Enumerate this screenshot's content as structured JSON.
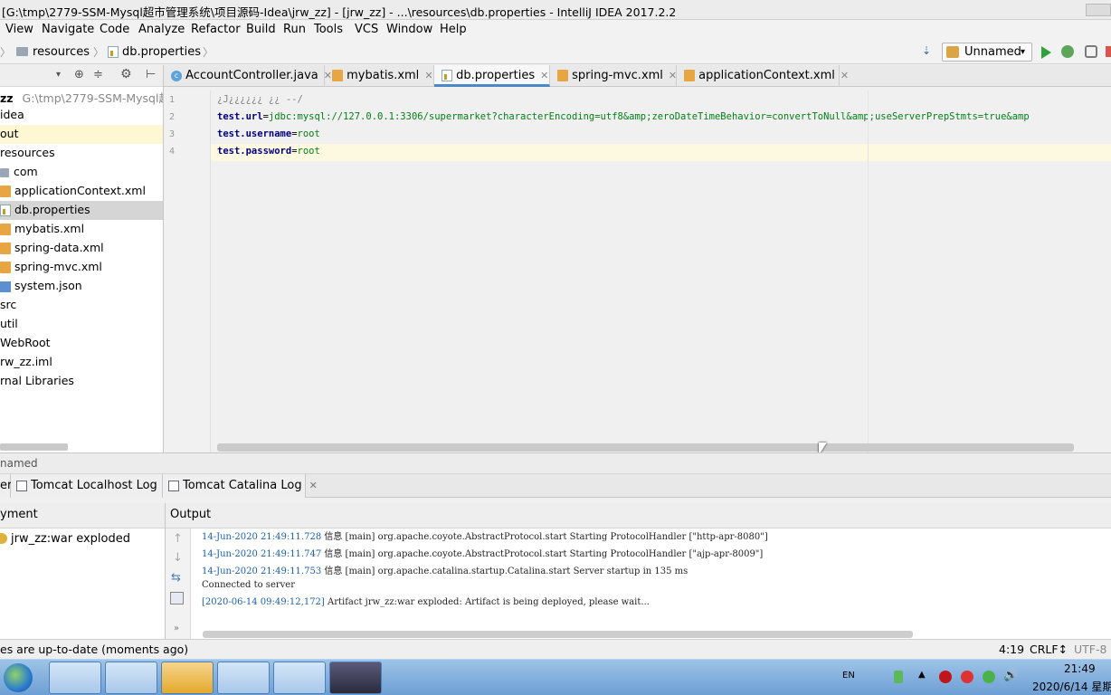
{
  "window": {
    "title": "[G:\\tmp\\2779-SSM-Mysql超市管理系统\\项目源码-Idea\\jrw_zz] - [jrw_zz] - ...\\resources\\db.properties - IntelliJ IDEA 2017.2.2"
  },
  "menu": [
    "View",
    "Navigate",
    "Code",
    "Analyze",
    "Refactor",
    "Build",
    "Run",
    "Tools",
    "VCS",
    "Window",
    "Help"
  ],
  "breadcrumb": {
    "folder": "resources",
    "file": "db.properties"
  },
  "run_config": {
    "name": "Unnamed"
  },
  "project": {
    "root_label": "zz",
    "root_path": "G:\\tmp\\2779-SSM-Mysql超市",
    "items": [
      "idea",
      "out",
      "resources",
      "com",
      "applicationContext.xml",
      "db.properties",
      "mybatis.xml",
      "spring-data.xml",
      "spring-mvc.xml",
      "system.json",
      "src",
      "util",
      "WebRoot",
      "rw_zz.iml",
      "rnal Libraries"
    ]
  },
  "tabs": [
    "AccountController.java",
    "mybatis.xml",
    "db.properties",
    "spring-mvc.xml",
    "applicationContext.xml"
  ],
  "editor": {
    "line_numbers": [
      "1",
      "2",
      "3",
      "4"
    ],
    "line1": "¿J¿¿¿¿¿¿  ¿¿ --/",
    "line2_key": "test.url",
    "line2_val": "jdbc:mysql://127.0.0.1:3306/supermarket?characterEncoding=utf8&amp;zeroDateTimeBehavior=convertToNull&amp;useServerPrepStmts=true&amp",
    "line3_key": "test.username",
    "line3_val": "root",
    "line4_key": "test.password",
    "line4_val": "root",
    "eq": "="
  },
  "run_panel": {
    "header": "named",
    "tab_left": "er",
    "tabs": [
      "Tomcat Localhost Log",
      "Tomcat Catalina Log"
    ],
    "deployment_label": "yment",
    "deployment_item": "jrw_zz:war exploded",
    "output_label": "Output",
    "logs": [
      {
        "date": "14-Jun-2020 21:49:11.728",
        "text": " 信息 [main] org.apache.coyote.AbstractProtocol.start Starting ProtocolHandler [\"http-apr-8080\"]"
      },
      {
        "date": "14-Jun-2020 21:49:11.747",
        "text": " 信息 [main] org.apache.coyote.AbstractProtocol.start Starting ProtocolHandler [\"ajp-apr-8009\"]"
      },
      {
        "date": "14-Jun-2020 21:49:11.753",
        "text": " 信息 [main] org.apache.catalina.startup.Catalina.start Server startup in 135 ms"
      },
      {
        "date": "",
        "text": "Connected to server"
      },
      {
        "date": "[2020-06-14 09:49:12,172]",
        "text": " Artifact jrw_zz:war exploded: Artifact is being deployed, please wait..."
      }
    ]
  },
  "status": {
    "message": "es are up-to-date (moments ago)",
    "position": "4:19",
    "line_sep": "CRLF↕",
    "encoding": "UTF-8"
  },
  "taskbar": {
    "lang": "EN",
    "time": "21:49",
    "date": "2020/6/14 星期"
  }
}
